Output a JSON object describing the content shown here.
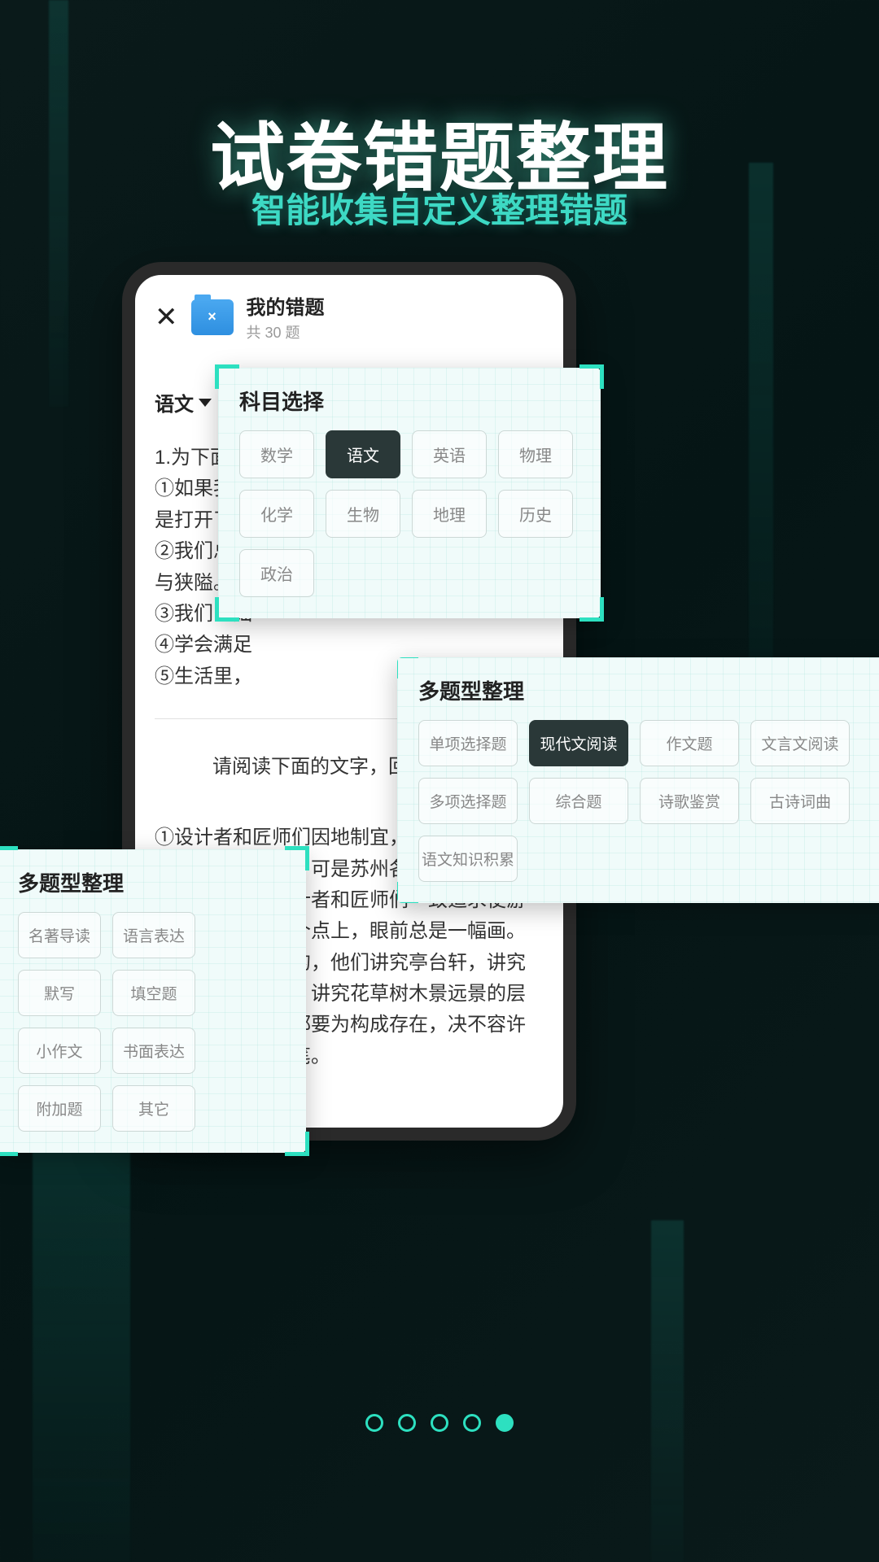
{
  "hero": {
    "title": "试卷错题整理",
    "subtitle": "智能收集自定义整理错题"
  },
  "phone": {
    "header_title": "我的错题",
    "header_count": "共 30 题",
    "subject_selected": "语文",
    "question_lines": [
      "1.为下面词",
      "①如果我们",
      "是打开了一",
      "②我们总是",
      "与狭隘。",
      "③我们的灿",
      "④学会满足",
      "⑤生活里，"
    ],
    "prompt": "请阅读下面的文字，回答问题。",
    "passage": "①设计者和匠师们因地制宜，自出心裁。园林当然各个不同。可是苏州各个园林有一个共同点，似乎设计者和匠师们一致追求使游览者无论站在哪个点上，眼前总是一幅画。为了达到这个目的，他们讲究亭台轩，讲究假山池沼的配合，讲究花草树木景远景的层次。总之，一切都要为构成存在，决不容许有欠美伤美的败笔。"
  },
  "panels": {
    "subject": {
      "title": "科目选择",
      "items": [
        "数学",
        "语文",
        "英语",
        "物理",
        "化学",
        "生物",
        "地理",
        "历史",
        "政治"
      ],
      "active": "语文"
    },
    "types_right": {
      "title": "多题型整理",
      "items": [
        "单项选择题",
        "现代文阅读",
        "作文题",
        "文言文阅读",
        "多项选择题",
        "综合题",
        "诗歌鉴赏",
        "古诗词曲",
        "语文知识积累"
      ],
      "active": "现代文阅读"
    },
    "types_left": {
      "title": "多题型整理",
      "items": [
        "名著导读",
        "语言表达",
        "默写",
        "填空题",
        "小作文",
        "书面表达",
        "附加题",
        "其它"
      ]
    }
  },
  "pager": {
    "count": 5,
    "active_index": 4
  }
}
